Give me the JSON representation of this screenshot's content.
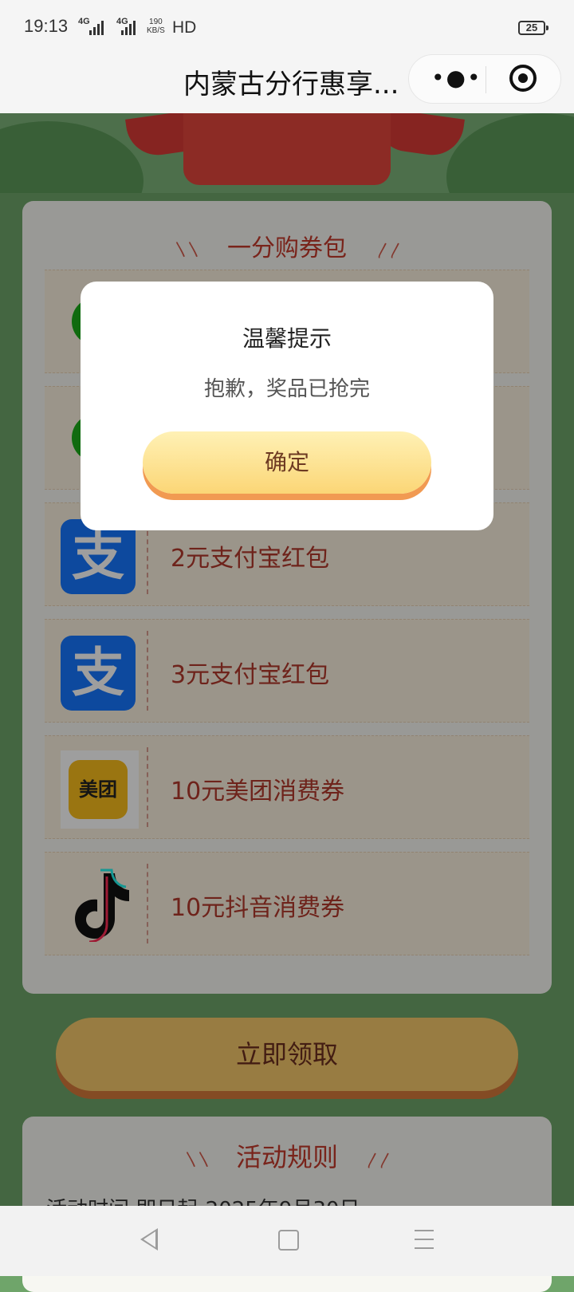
{
  "status_bar": {
    "time": "19:13",
    "network1": "4G",
    "network2": "4G",
    "speed_value": "190",
    "speed_unit": "KB/S",
    "hd": "HD",
    "battery": "25"
  },
  "title_bar": {
    "title": "内蒙古分行惠享...",
    "more_icon": "more-dots-icon",
    "close_icon": "miniprogram-close-icon"
  },
  "coupon_section": {
    "title": "一分购券包",
    "items": [
      {
        "label": "",
        "icon": "green-wechat-icon"
      },
      {
        "label": "",
        "icon": "green-wechat-icon"
      },
      {
        "label": "2元支付宝红包",
        "icon": "alipay-icon",
        "icon_text": "支"
      },
      {
        "label": "3元支付宝红包",
        "icon": "alipay-icon",
        "icon_text": "支"
      },
      {
        "label": "10元美团消费券",
        "icon": "meituan-icon",
        "icon_text": "美团"
      },
      {
        "label": "10元抖音消费券",
        "icon": "douyin-icon"
      }
    ]
  },
  "claim_button": "立即领取",
  "rules": {
    "title": "活动规则",
    "text": "活动时间 即日起-2025年9月30日"
  },
  "dialog": {
    "title": "温馨提示",
    "message": "抱歉，奖品已抢完",
    "confirm": "确定"
  },
  "colors": {
    "accent_red": "#c43a2d",
    "button_yellow": "#fbd676",
    "button_shadow": "#f19a52",
    "alipay_blue": "#1677ff",
    "meituan_yellow": "#f8bd1c",
    "background_green": "#6fa56a"
  }
}
